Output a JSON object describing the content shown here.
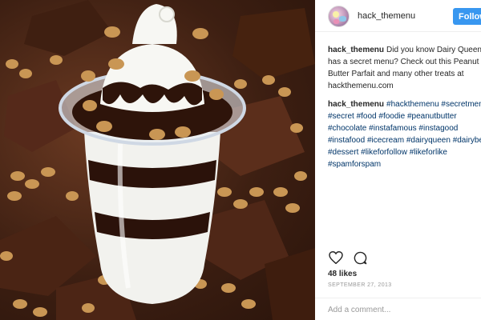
{
  "header": {
    "username": "hack_themenu",
    "follow_label": "Follow"
  },
  "caption": {
    "username": "hack_themenu",
    "text": "Did you know Dairy Queen has a secret menu? Check out this Peanut Butter Parfait and many other treats at hackthemenu.com"
  },
  "hashtag_comment": {
    "username": "hack_themenu",
    "hashtags": [
      "#hackthemenu",
      "#secretmenu",
      "#secret",
      "#food",
      "#foodie",
      "#peanutbutter",
      "#chocolate",
      "#instafamous",
      "#instagood",
      "#instafood",
      "#icecream",
      "#dairyqueen",
      "#dairybell",
      "#dessert",
      "#likeforfollow",
      "#likeforlike",
      "#spamforspam"
    ]
  },
  "actions": {
    "like_icon": "heart-icon",
    "comment_icon": "speech-bubble-icon"
  },
  "likes": "48 likes",
  "date": "SEPTEMBER 27, 2013",
  "add_comment": {
    "placeholder": "Add a comment..."
  },
  "colors": {
    "follow_button": "#3897f0",
    "hashtag_link": "#003569",
    "muted_text": "#999999"
  },
  "photo": {
    "subject": "Peanut butter parfait sundae with chocolate fudge and peanuts"
  }
}
